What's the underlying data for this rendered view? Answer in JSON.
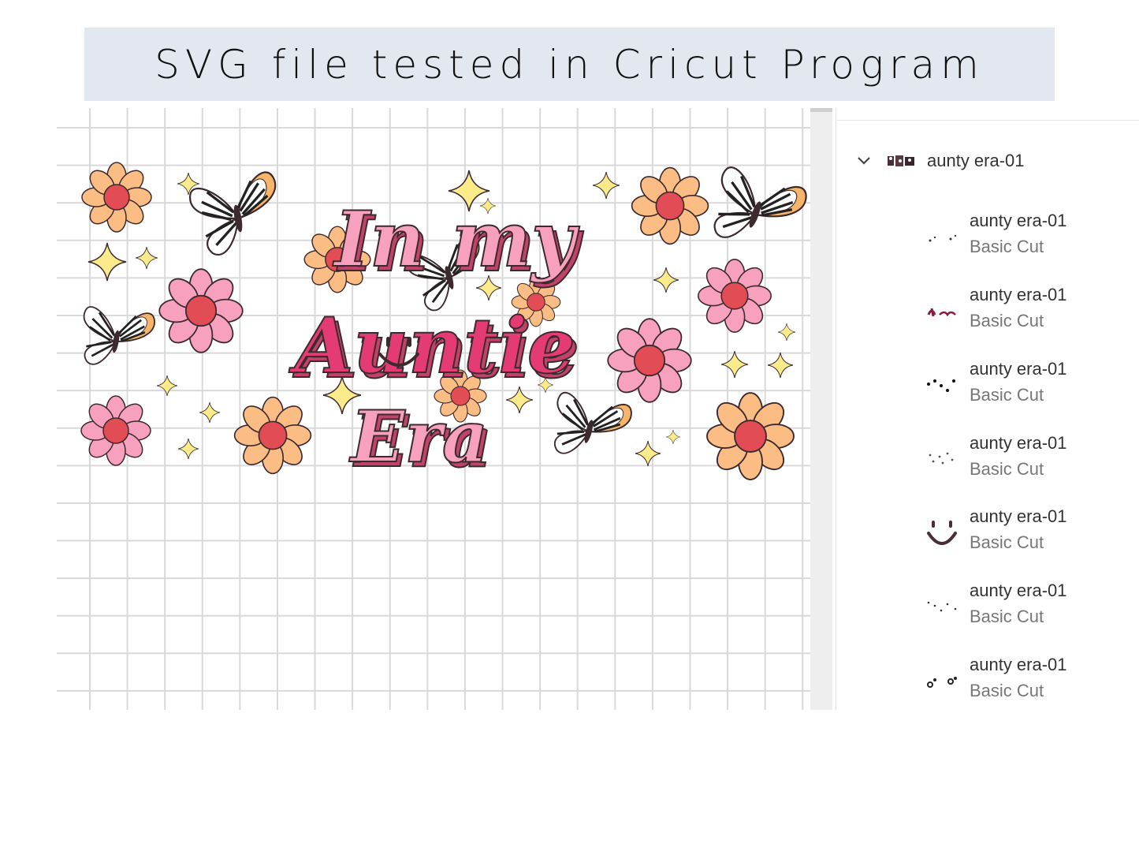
{
  "banner": {
    "title": "SVG file tested in Cricut Program"
  },
  "design": {
    "lines": [
      "In my",
      "Auntie",
      "Era"
    ],
    "colors": {
      "light_pink": "#f7a1bf",
      "hot_pink": "#e43b74",
      "shadow": "#c2436a",
      "peach": "#fbbd84",
      "flower_center": "#e24c55",
      "star": "#fbeb8a",
      "outline": "#3d2a2e"
    },
    "icons": [
      "flower-icon",
      "butterfly-icon",
      "sparkle-icon",
      "smiley-icon"
    ]
  },
  "layers_panel": {
    "group": {
      "name": "aunty era-01",
      "expand_icon": "chevron-down-icon",
      "expanded": true
    },
    "layers": [
      {
        "name": "aunty era-01",
        "operation": "Basic Cut",
        "thumb": "sparse-dots"
      },
      {
        "name": "aunty era-01",
        "operation": "Basic Cut",
        "thumb": "text-shape"
      },
      {
        "name": "aunty era-01",
        "operation": "Basic Cut",
        "thumb": "dark-dots"
      },
      {
        "name": "aunty era-01",
        "operation": "Basic Cut",
        "thumb": "light-dots"
      },
      {
        "name": "aunty era-01",
        "operation": "Basic Cut",
        "thumb": "smiley"
      },
      {
        "name": "aunty era-01",
        "operation": "Basic Cut",
        "thumb": "sparse-dots-2"
      },
      {
        "name": "aunty era-01",
        "operation": "Basic Cut",
        "thumb": "circles"
      }
    ]
  }
}
